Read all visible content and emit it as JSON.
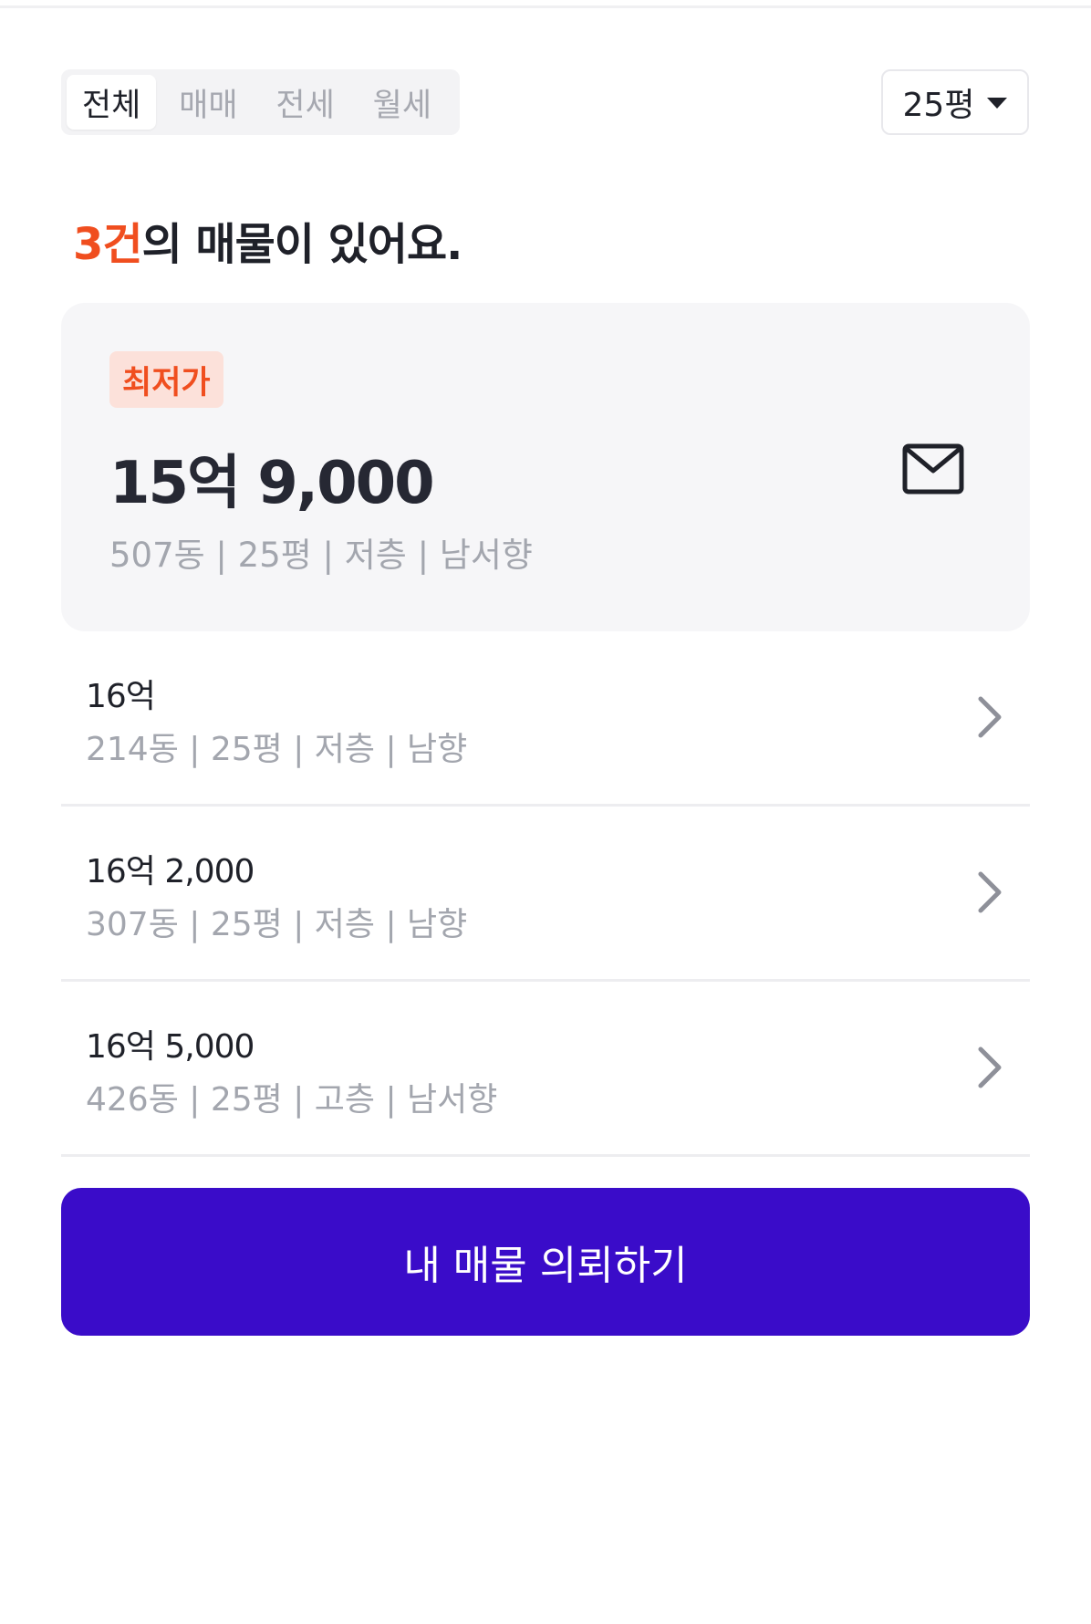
{
  "filter": {
    "tabs": [
      {
        "label": "전체",
        "active": true
      },
      {
        "label": "매매",
        "active": false
      },
      {
        "label": "전세",
        "active": false
      },
      {
        "label": "월세",
        "active": false
      }
    ],
    "size_select": "25평"
  },
  "headline": {
    "count": "3건",
    "rest": "의 매물이 있어요."
  },
  "best": {
    "badge": "최저가",
    "price": "15억 9,000",
    "meta": "507동 | 25평 | 저층 | 남서향",
    "icon": "mail-icon"
  },
  "listings": [
    {
      "price": "16억",
      "meta": "214동 | 25평 | 저층 | 남향"
    },
    {
      "price": "16억 2,000",
      "meta": "307동 | 25평 | 저층 | 남향"
    },
    {
      "price": "16억 5,000",
      "meta": "426동 | 25평 | 고층 | 남서향"
    }
  ],
  "cta": "내 매물 의뢰하기",
  "colors": {
    "accent": "#f04e1f",
    "primary": "#3a0cc9"
  }
}
